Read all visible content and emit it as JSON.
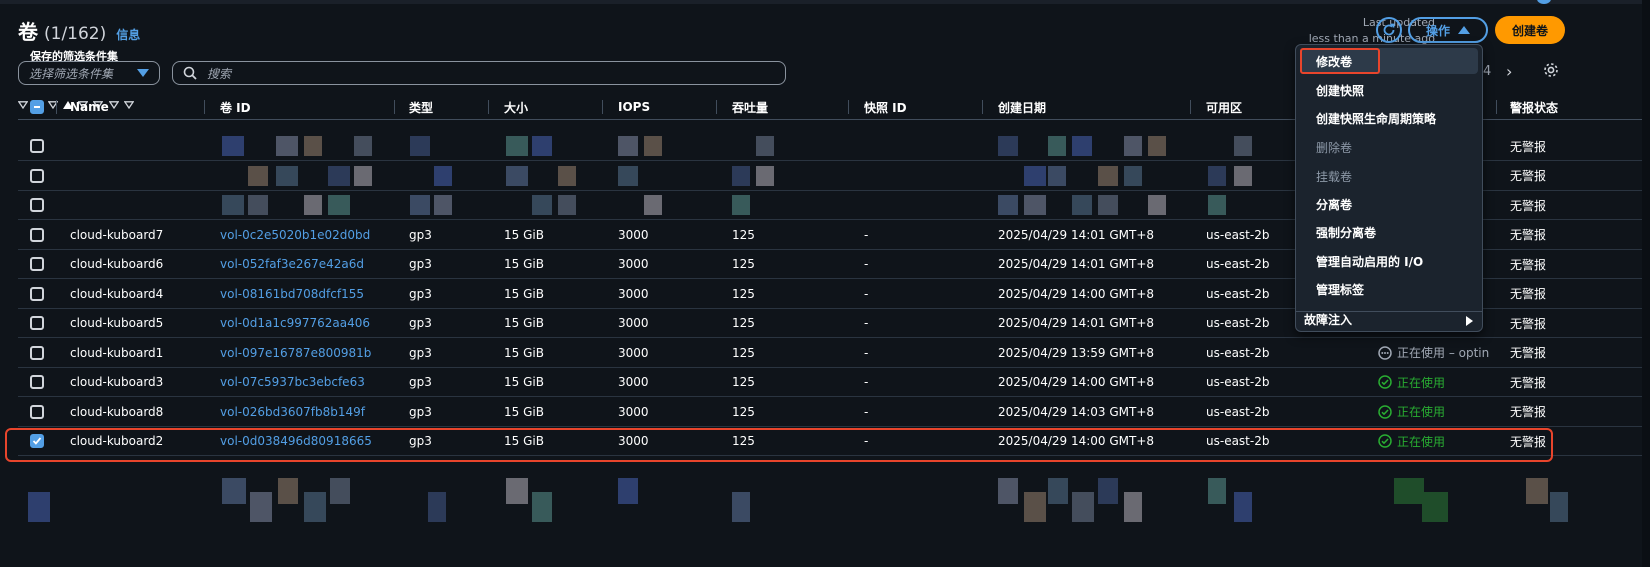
{
  "page": {
    "title": "卷",
    "count": "(1/162)",
    "info_link": "信息",
    "last_updated_label": "Last updated",
    "last_updated_value": "less than a minute ago",
    "actions_label": "操作",
    "create_label": "创建卷",
    "saved_filter_label": "保存的筛选条件集",
    "saved_filter_placeholder": "选择筛选条件集",
    "search_placeholder": "搜索",
    "page_number": "4"
  },
  "columns": [
    "Name",
    "卷 ID",
    "类型",
    "大小",
    "IOPS",
    "吞吐量",
    "快照 ID",
    "创建日期",
    "可用区",
    "警报状态"
  ],
  "rows": [
    {
      "name": "",
      "id": "",
      "type": "",
      "size": "",
      "iops": "",
      "throughput": "",
      "snapshot": "",
      "created": "",
      "az": "",
      "volume_state": "",
      "alarm": "无警报",
      "checked": false,
      "redacted": true
    },
    {
      "name": "",
      "id": "",
      "type": "",
      "size": "",
      "iops": "",
      "throughput": "",
      "snapshot": "",
      "created": "",
      "az": "",
      "volume_state": "",
      "alarm": "无警报",
      "checked": false,
      "redacted": true
    },
    {
      "name": "",
      "id": "",
      "type": "",
      "size": "",
      "iops": "",
      "throughput": "",
      "snapshot": "",
      "created": "",
      "az": "",
      "volume_state": "",
      "alarm": "无警报",
      "checked": false,
      "redacted": true
    },
    {
      "name": "cloud-kuboard7",
      "id": "vol-0c2e5020b1e02d0bd",
      "type": "gp3",
      "size": "15 GiB",
      "iops": "3000",
      "throughput": "125",
      "snapshot": "-",
      "created": "2025/04/29 14:01 GMT+8",
      "az": "us-east-2b",
      "volume_state": "",
      "alarm": "无警报",
      "checked": false
    },
    {
      "name": "cloud-kuboard6",
      "id": "vol-052faf3e267e42a6d",
      "type": "gp3",
      "size": "15 GiB",
      "iops": "3000",
      "throughput": "125",
      "snapshot": "-",
      "created": "2025/04/29 14:01 GMT+8",
      "az": "us-east-2b",
      "volume_state": "",
      "alarm": "无警报",
      "checked": false
    },
    {
      "name": "cloud-kuboard4",
      "id": "vol-08161bd708dfcf155",
      "type": "gp3",
      "size": "15 GiB",
      "iops": "3000",
      "throughput": "125",
      "snapshot": "-",
      "created": "2025/04/29 14:00 GMT+8",
      "az": "us-east-2b",
      "volume_state": "",
      "alarm": "无警报",
      "checked": false
    },
    {
      "name": "cloud-kuboard5",
      "id": "vol-0d1a1c997762aa406",
      "type": "gp3",
      "size": "15 GiB",
      "iops": "3000",
      "throughput": "125",
      "snapshot": "-",
      "created": "2025/04/29 14:01 GMT+8",
      "az": "us-east-2b",
      "volume_state": "",
      "alarm": "无警报",
      "checked": false
    },
    {
      "name": "cloud-kuboard1",
      "id": "vol-097e16787e800981b",
      "type": "gp3",
      "size": "15 GiB",
      "iops": "3000",
      "throughput": "125",
      "snapshot": "-",
      "created": "2025/04/29 13:59 GMT+8",
      "az": "us-east-2b",
      "volume_state": "正在使用 – optin",
      "state_kind": "pending",
      "alarm": "无警报",
      "checked": false
    },
    {
      "name": "cloud-kuboard3",
      "id": "vol-07c5937bc3ebcfe63",
      "type": "gp3",
      "size": "15 GiB",
      "iops": "3000",
      "throughput": "125",
      "snapshot": "-",
      "created": "2025/04/29 14:00 GMT+8",
      "az": "us-east-2b",
      "volume_state": "正在使用",
      "state_kind": "ok",
      "alarm": "无警报",
      "checked": false
    },
    {
      "name": "cloud-kuboard8",
      "id": "vol-026bd3607fb8b149f",
      "type": "gp3",
      "size": "15 GiB",
      "iops": "3000",
      "throughput": "125",
      "snapshot": "-",
      "created": "2025/04/29 14:03 GMT+8",
      "az": "us-east-2b",
      "volume_state": "正在使用",
      "state_kind": "ok",
      "alarm": "无警报",
      "checked": false
    },
    {
      "name": "cloud-kuboard2",
      "id": "vol-0d038496d80918665",
      "type": "gp3",
      "size": "15 GiB",
      "iops": "3000",
      "throughput": "125",
      "snapshot": "-",
      "created": "2025/04/29 14:00 GMT+8",
      "az": "us-east-2b",
      "volume_state": "正在使用",
      "state_kind": "ok",
      "alarm": "无警报",
      "checked": true
    }
  ],
  "menu": {
    "items": [
      {
        "label": "修改卷",
        "enabled": true
      },
      {
        "label": "创建快照",
        "enabled": true
      },
      {
        "label": "创建快照生命周期策略",
        "enabled": true
      },
      {
        "label": "删除卷",
        "enabled": false
      },
      {
        "label": "挂载卷",
        "enabled": false
      },
      {
        "label": "分离卷",
        "enabled": true
      },
      {
        "label": "强制分离卷",
        "enabled": true
      },
      {
        "label": "管理自动启用的 I/O",
        "enabled": true
      },
      {
        "label": "管理标签",
        "enabled": true
      }
    ],
    "submenu_label": "故障注入"
  },
  "colors": {
    "accent": "#539fe5",
    "primary": "#ff9900",
    "ok": "#29ad32",
    "highlight": "#e8452c",
    "background": "#0f141a"
  }
}
